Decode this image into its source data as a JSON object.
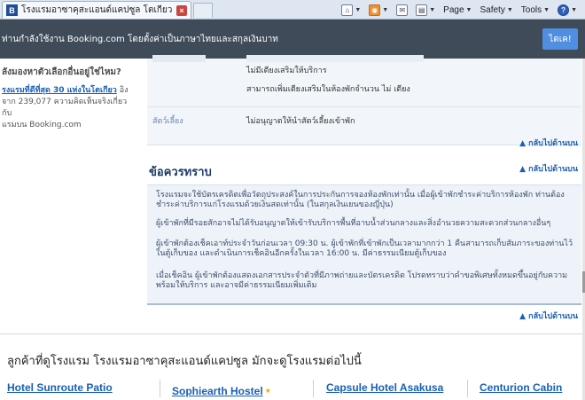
{
  "browser": {
    "tab_title": "โรงแรมอาซาคุสะแอนด์แคปซูล โตเกียว ญี่ปุ่น - Bookin...",
    "favicon_letter": "B",
    "toolbar": {
      "page_label": "Page",
      "safety_label": "Safety",
      "tools_label": "Tools"
    }
  },
  "translate_bar": {
    "text": "ท่านกำลังใช้งาน Booking.com โดยตั้งค่าเป็นภาษาไทยและสกุลเงินบาท",
    "button": "ไดเค!"
  },
  "sidebar": {
    "title": "ลังมองหาตัวเลือกอื่นอยู่ใช่ไหม?",
    "link_text": "รงแรมที่ดีที่สุด 30 แห่งในโตเกียว",
    "text_after_link": " อิง",
    "body_line2": "จาก 239,077 ความคิดเห็นจริงเกี่ยวกับ",
    "body_line3": "แรมบน Booking.com"
  },
  "policies": {
    "extra_bed_1": "ไม่มีเตียงเสริมให้บริการ",
    "extra_bed_2": "สามารถเพิ่มเตียงเสริมในห้องพักจำนวน  ไม่  เตียง",
    "pets_label": "สัตว์เลี้ยง",
    "pets_text": "ไม่อนุญาตให้นำสัตว์เลี้ยงเข้าพัก"
  },
  "back_to_top": "▲ กลับไปด้านบน",
  "notes": {
    "title": "ข้อควรทราบ",
    "items": [
      "โรงแรมจะใช้บัตรเครดิตเพื่อวัตถุประสงค์ในการประกันการจองห้องพักเท่านั้น เมื่อผู้เข้าพักชำระค่าบริการห้องพัก ท่านต้องชำระค่าบริการแก่โรงแรมด้วยเงินสดเท่านั้น (ในสกุลเงินเยนของญี่ปุ่น)",
      "ผู้เข้าพักที่มีรอยสักอาจไม่ได้รับอนุญาตให้เข้ารับบริการพื้นที่อาบน้ำส่วนกลางและสิ่งอำนวยความสะดวกส่วนกลางอื่นๆ",
      "ผู้เข้าพักต้องเช็คเอาท์ประจำวันก่อนเวลา 09:30 น. ผู้เข้าพักที่เข้าพักเป็นเวลามากกว่า 1 คืนสามารถเก็บสัมภาระของท่านไว้ในตู้เก็บของ และดำเนินการเช็คอินอีกครั้งในเวลา 16:00 น. มีค่าธรรมเนียมตู้เก็บของ",
      "เมื่อเช็คอิน ผู้เข้าพักต้องแสดงเอกสารประจำตัวที่มีภาพถ่ายและบัตรเครดิต โปรดทราบว่าคำขอพิเศษทั้งหมดขึ้นอยู่กับความพร้อมให้บริการ และอาจมีค่าธรรมเนียมเพิ่มเติม"
    ]
  },
  "also_viewed": {
    "title": "ลูกค้าที่ดูโรงแรม โรงแรมอาซาคุสะแอนด์แคปซูล มักจะดูโรงแรมต่อไปนี้",
    "hotels": [
      "Hotel Sunroute Patio",
      "Sophiearth Hostel",
      "Capsule Hotel Asakusa",
      "Centurion Cabin"
    ]
  },
  "colors": {
    "link": "#1a5fb4",
    "translate_bar_bg": "#3f4b59",
    "translate_button": "#4f8ee0",
    "section_title": "#1d3b66",
    "notes_bg": "#eef3f9",
    "star": "#f2a900"
  }
}
